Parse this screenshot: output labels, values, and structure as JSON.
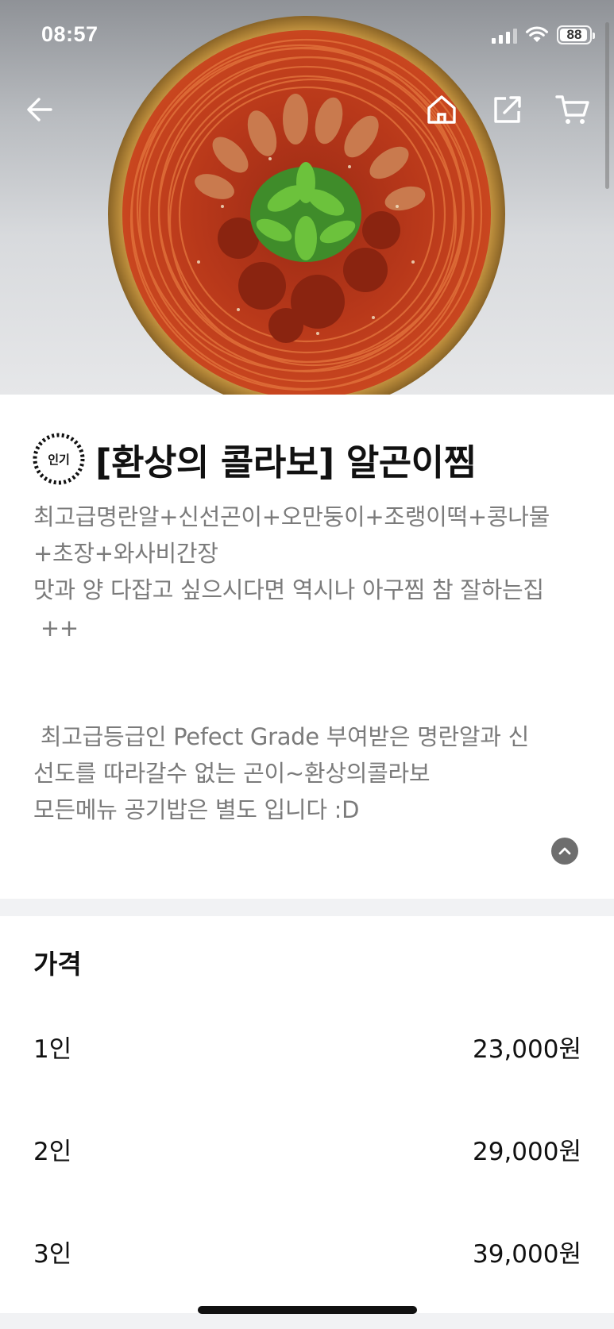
{
  "status_bar": {
    "time": "08:57",
    "battery": "88"
  },
  "nav": {
    "back_icon": "arrow-left-icon",
    "home_icon": "home-icon",
    "share_icon": "share-icon",
    "cart_icon": "cart-icon"
  },
  "hero": {
    "image": "spicy-seafood-jjim-platter"
  },
  "menu": {
    "badge": "인기",
    "title": "[환상의 콜라보] 알곤이찜",
    "description_lines": [
      "최고급명란알+신선곤이+오만둥이+조랭이떡+콩나물",
      "+초장+와사비간장",
      "맛과 양 다잡고 싶으시다면 역시나 아구찜 참 잘하는집",
      " ++",
      " 최고급등급인 Pefect Grade 부여받은 명란알과 신",
      "선도를 따라갈수 없는 곤이~환상의콜라보",
      "모든메뉴 공기밥은 별도 입니다 :D"
    ]
  },
  "price": {
    "heading": "가격",
    "options": [
      {
        "label": "1인",
        "price": "23,000원"
      },
      {
        "label": "2인",
        "price": "29,000원"
      },
      {
        "label": "3인",
        "price": "39,000원"
      }
    ]
  },
  "colors": {
    "accent": "#111111",
    "muted_text": "#7b7b7b",
    "divider": "#f1f2f4"
  }
}
